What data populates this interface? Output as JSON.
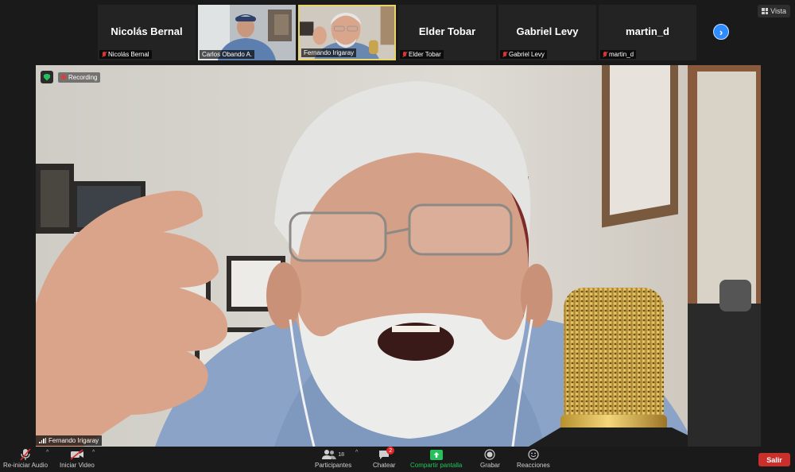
{
  "view_button": {
    "label": "Vista",
    "icon": "grid-icon"
  },
  "thumbnails": [
    {
      "display_name": "Nicolás Bernal",
      "label": "Nicolás Bernal",
      "muted": true,
      "video": false
    },
    {
      "display_name": "",
      "label": "Carlos Obando A.",
      "muted": false,
      "video": true
    },
    {
      "display_name": "",
      "label": "Fernando Irigaray",
      "muted": false,
      "video": true,
      "active_speaker": true
    },
    {
      "display_name": "Elder Tobar",
      "label": "Elder Tobar",
      "muted": true,
      "video": false
    },
    {
      "display_name": "Gabriel Levy",
      "label": "Gabriel Levy",
      "muted": true,
      "video": false
    },
    {
      "display_name": "martin_d",
      "label": "martin_d",
      "muted": true,
      "video": false
    }
  ],
  "next_page_icon": "chevron-right-icon",
  "recording": {
    "label": "Recording",
    "indicator_color": "#e23b3b",
    "shield_color": "#25c25c"
  },
  "main_speaker": {
    "name": "Fernando Irigaray"
  },
  "toolbar": {
    "audio_label": "Re-iniciar Audio",
    "video_label": "Iniciar Video",
    "participants_label": "Participantes",
    "participants_count": "18",
    "chat_label": "Chatear",
    "chat_badge": "2",
    "share_label": "Compartir pantalla",
    "record_label": "Grabar",
    "reactions_label": "Reacciones",
    "leave_label": "Salir"
  },
  "colors": {
    "accent": "#2d8cff",
    "share_green": "#25c25c",
    "leave_red": "#c9302c",
    "active_border": "#e8d56a"
  }
}
